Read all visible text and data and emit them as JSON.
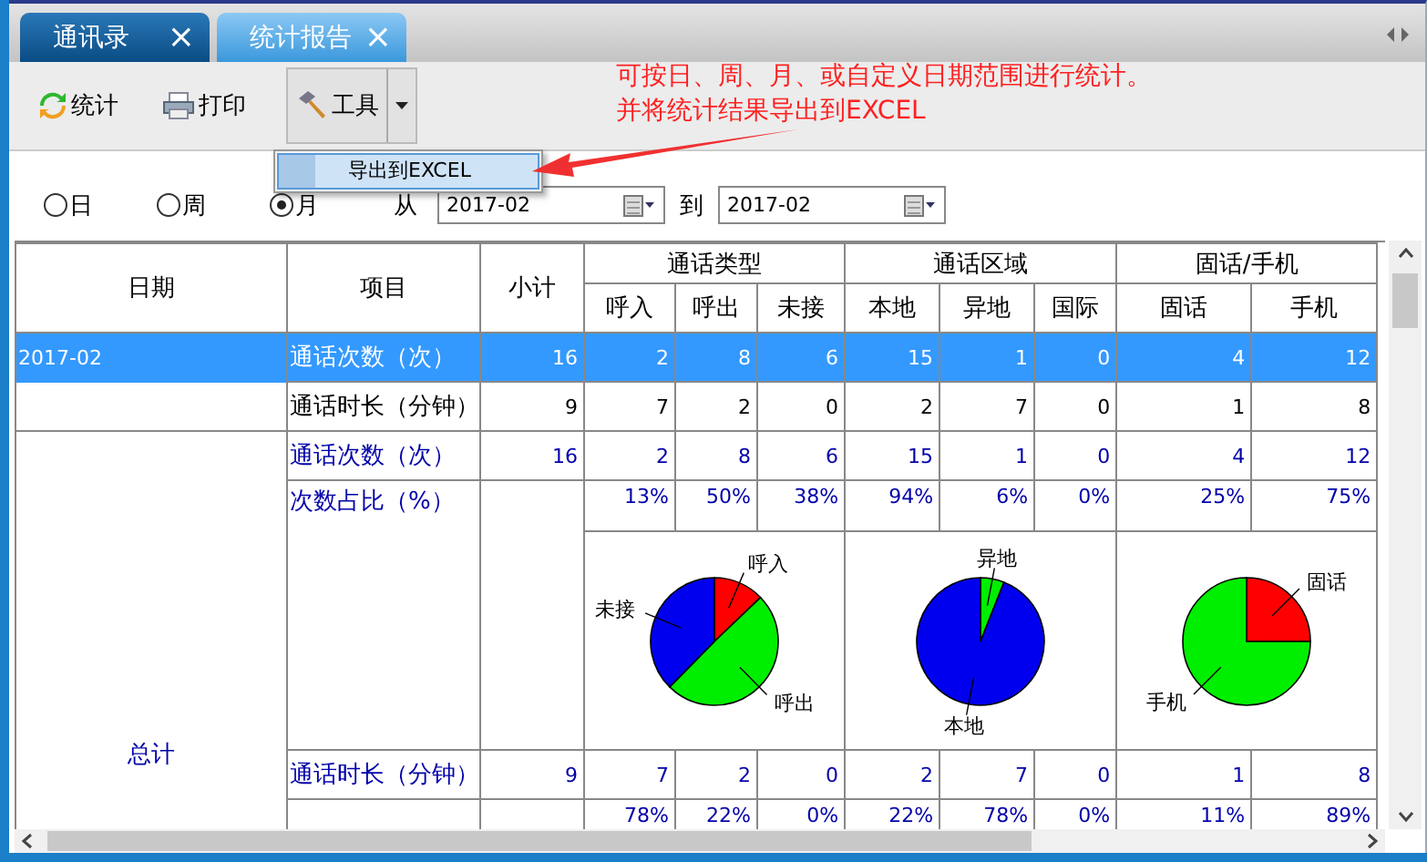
{
  "tabs": [
    {
      "label": "通讯录",
      "close": "×",
      "selected": false
    },
    {
      "label": "统计报告",
      "close": "×",
      "selected": true
    }
  ],
  "toolbar": [
    {
      "label": "统计",
      "kind": "button"
    },
    {
      "label": "打印",
      "kind": "button"
    },
    {
      "label": "工具",
      "kind": "split",
      "open": true
    }
  ],
  "menu": {
    "items": [
      {
        "label": "导出到EXCEL",
        "selected": true
      }
    ]
  },
  "annotation": {
    "lines": [
      "可按日、周、月、或自定义日期范围进行统计。",
      "并将统计结果导出到EXCEL"
    ]
  },
  "filter": {
    "periods": [
      {
        "label": "日",
        "selected": false
      },
      {
        "label": "周",
        "selected": false
      },
      {
        "label": "月",
        "selected": true
      }
    ],
    "from_label": "从",
    "from_value": "2017-02",
    "to_label": "到",
    "to_value": "2017-02"
  },
  "table": {
    "columns": [
      "日期",
      "项目",
      "小计"
    ],
    "groups": [
      {
        "label": "通话类型",
        "columns": [
          "呼入",
          "呼出",
          "未接"
        ]
      },
      {
        "label": "通话区域",
        "columns": [
          "本地",
          "异地",
          "国际"
        ]
      },
      {
        "label": "固话/手机",
        "columns": [
          "固话",
          "手机"
        ]
      }
    ],
    "periods": [
      {
        "date": "2017-02",
        "rows": [
          {
            "item": "通话次数（次）",
            "selected": true,
            "values": [
              "16",
              "2",
              "8",
              "6",
              "15",
              "1",
              "0",
              "4",
              "12"
            ]
          },
          {
            "item": "通话时长（分钟）",
            "selected": false,
            "values": [
              "9",
              "7",
              "2",
              "0",
              "2",
              "7",
              "0",
              "1",
              "8"
            ]
          }
        ]
      }
    ],
    "total": {
      "label": "总计",
      "rows": [
        {
          "kind": "values",
          "item": "通话次数（次）",
          "values": [
            "16",
            "2",
            "8",
            "6",
            "15",
            "1",
            "0",
            "4",
            "12"
          ]
        },
        {
          "kind": "percent",
          "item": "次数占比（%）",
          "values": [
            "13%",
            "50%",
            "38%",
            "94%",
            "6%",
            "0%",
            "25%",
            "75%"
          ],
          "charts": [
            {
              "chart_data": {
                "type": "pie",
                "categories": [
                  "呼入",
                  "呼出",
                  "未接"
                ],
                "colors": [
                  "#ff0000",
                  "#00ee00",
                  "#0000ee"
                ],
                "values": [
                  13,
                  50,
                  38
                ]
              }
            },
            {
              "chart_data": {
                "type": "pie",
                "categories": [
                  "异地",
                  "本地"
                ],
                "colors": [
                  "#00ee00",
                  "#0000ee"
                ],
                "values": [
                  6,
                  94
                ]
              }
            },
            {
              "chart_data": {
                "type": "pie",
                "categories": [
                  "固话",
                  "手机"
                ],
                "colors": [
                  "#ff0000",
                  "#00ee00"
                ],
                "values": [
                  25,
                  75
                ]
              }
            }
          ]
        },
        {
          "kind": "values",
          "item": "通话时长（分钟）",
          "values": [
            "9",
            "7",
            "2",
            "0",
            "2",
            "7",
            "0",
            "1",
            "8"
          ]
        },
        {
          "kind": "percent",
          "values": [
            "78%",
            "22%",
            "0%",
            "22%",
            "78%",
            "0%",
            "11%",
            "89%"
          ]
        }
      ]
    }
  }
}
